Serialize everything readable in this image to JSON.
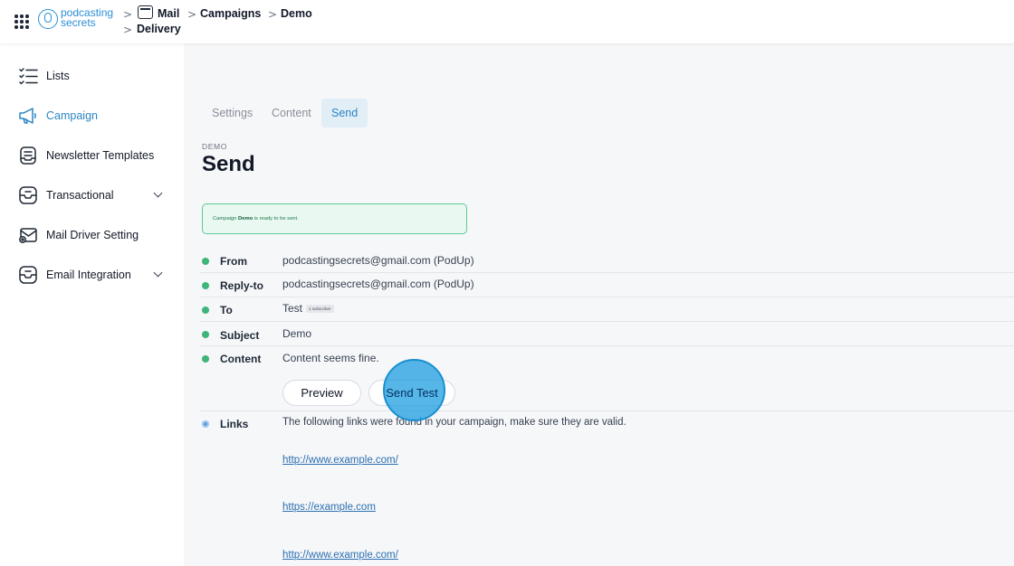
{
  "header": {
    "logo_line1": "podcasting",
    "logo_line2": "secrets",
    "crumb_mail": "Mail",
    "crumb_delivery": "Delivery",
    "crumb_campaigns": "Campaigns",
    "crumb_demo": "Demo",
    "sep": ">"
  },
  "sidebar": {
    "items": [
      {
        "label": "Lists",
        "icon": "list-check-icon"
      },
      {
        "label": "Campaign",
        "icon": "megaphone-icon",
        "active": true
      },
      {
        "label": "Newsletter Templates",
        "icon": "template-icon"
      },
      {
        "label": "Transactional",
        "icon": "inbox-icon",
        "expandable": true
      },
      {
        "label": "Mail Driver Setting",
        "icon": "mail-settings-icon"
      },
      {
        "label": "Email Integration",
        "icon": "inbox-icon",
        "expandable": true
      }
    ]
  },
  "tabs": [
    "Settings",
    "Content",
    "Send"
  ],
  "page": {
    "pretitle": "DEMO",
    "title": "Send",
    "alert_prefix": "Campaign ",
    "alert_name": "Demo",
    "alert_suffix": " is ready to be sent."
  },
  "summary": {
    "from_key": "From",
    "from_val": "podcastingsecrets@gmail.com (PodUp)",
    "replyto_key": "Reply-to",
    "replyto_val": "podcastingsecrets@gmail.com (PodUp)",
    "to_key": "To",
    "to_val": "Test",
    "to_badge": "1 subscriber",
    "subject_key": "Subject",
    "subject_val": "Demo",
    "content_key": "Content",
    "content_val": "Content seems fine.",
    "preview_btn": "Preview",
    "send_test_btn": "Send Test",
    "links_key": "Links",
    "links_val": "The following links were found in your campaign, make sure they are valid.",
    "links": [
      "http://www.example.com/",
      "https://example.com",
      "http://www.example.com/"
    ]
  },
  "colors": {
    "accent": "#2b86c5",
    "ok_dot": "#3fb57a",
    "alert_border": "#5ec898",
    "alert_bg": "#e9f8f0"
  }
}
